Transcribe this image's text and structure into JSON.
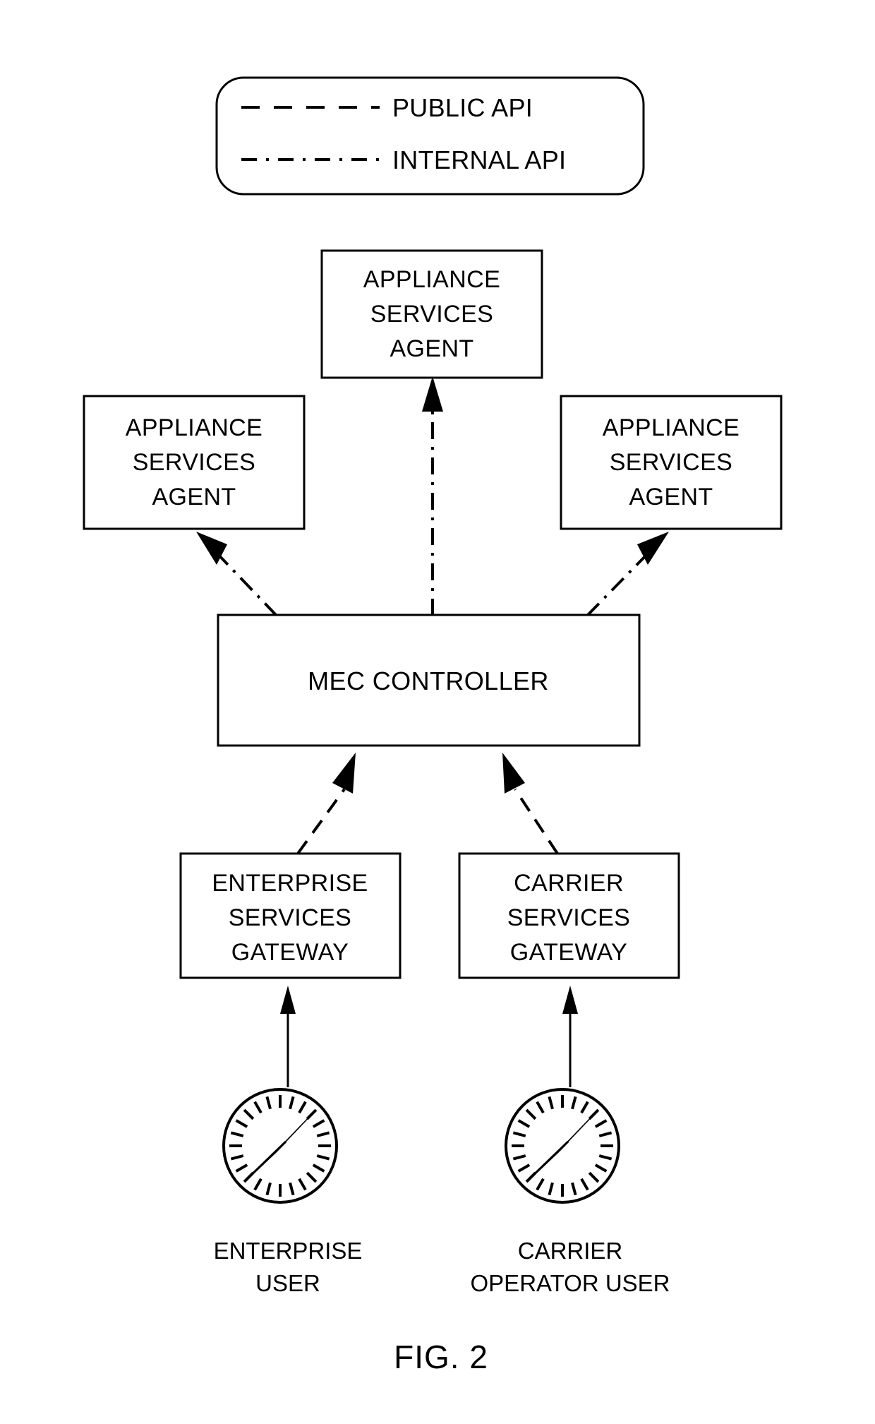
{
  "figure": {
    "caption": "FIG. 2",
    "legend": {
      "public_api_label": "PUBLIC API",
      "internal_api_label": "INTERNAL API",
      "public_api_style": "dashed",
      "internal_api_style": "dash-dot"
    },
    "nodes": {
      "appliance_agent_top": "APPLIANCE\nSERVICES\nAGENT",
      "appliance_agent_top_line1": "APPLIANCE",
      "appliance_agent_top_line2": "SERVICES",
      "appliance_agent_top_line3": "AGENT",
      "appliance_agent_left_line1": "APPLIANCE",
      "appliance_agent_left_line2": "SERVICES",
      "appliance_agent_left_line3": "AGENT",
      "appliance_agent_right_line1": "APPLIANCE",
      "appliance_agent_right_line2": "SERVICES",
      "appliance_agent_right_line3": "AGENT",
      "mec_controller": "MEC CONTROLLER",
      "enterprise_gateway_line1": "ENTERPRISE",
      "enterprise_gateway_line2": "SERVICES",
      "enterprise_gateway_line3": "GATEWAY",
      "carrier_gateway_line1": "CARRIER",
      "carrier_gateway_line2": "SERVICES",
      "carrier_gateway_line3": "GATEWAY"
    },
    "user_labels": {
      "enterprise_user_line1": "ENTERPRISE",
      "enterprise_user_line2": "USER",
      "carrier_user_line1": "CARRIER",
      "carrier_user_line2": "OPERATOR USER"
    },
    "icons": {
      "enterprise_user_icon": "compass-browser-icon",
      "carrier_user_icon": "compass-browser-icon"
    },
    "colors": {
      "stroke": "#000000",
      "background": "#ffffff"
    }
  }
}
